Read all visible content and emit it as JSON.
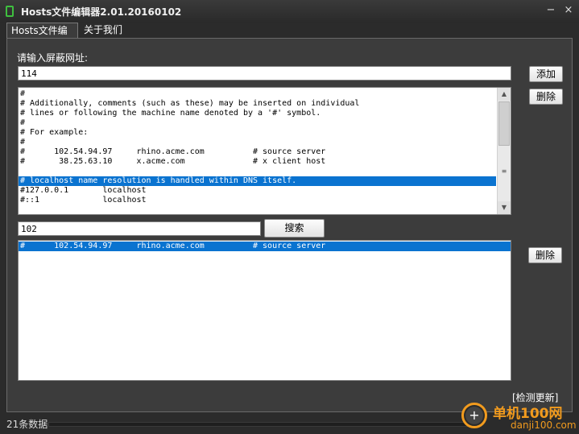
{
  "window": {
    "title": "Hosts文件编辑器2.01.20160102",
    "minimize": "−",
    "close": "×"
  },
  "tabs": [
    {
      "label": "Hosts文件编辑",
      "active": true
    },
    {
      "label": "关于我们",
      "active": false
    }
  ],
  "block": {
    "label": "请输入屏蔽网址:",
    "input_value": "114",
    "add_label": "添加",
    "delete_label": "删除"
  },
  "hosts_editor": {
    "lines": [
      "#",
      "# Additionally, comments (such as these) may be inserted on individual",
      "# lines or following the machine name denoted by a '#' symbol.",
      "#",
      "# For example:",
      "#",
      "#      102.54.94.97     rhino.acme.com          # source server",
      "#       38.25.63.10     x.acme.com              # x client host",
      "",
      "# localhost name resolution is handled within DNS itself.",
      "#127.0.0.1       localhost",
      "#::1             localhost"
    ],
    "selected_index": 9
  },
  "search": {
    "input_value": "102",
    "button_label": "搜索"
  },
  "results": {
    "lines": [
      "#      102.54.94.97     rhino.acme.com          # source server"
    ],
    "selected_index": 0,
    "delete_label": "删除"
  },
  "status": {
    "count_text": "21条数据",
    "update_link": "[检测更新]"
  },
  "watermark": {
    "name": "单机100网",
    "domain": "danji100.com"
  },
  "colors": {
    "accent_selection": "#0a73d0",
    "watermark": "#f29b1e",
    "icon_green": "#3fbf3f"
  }
}
